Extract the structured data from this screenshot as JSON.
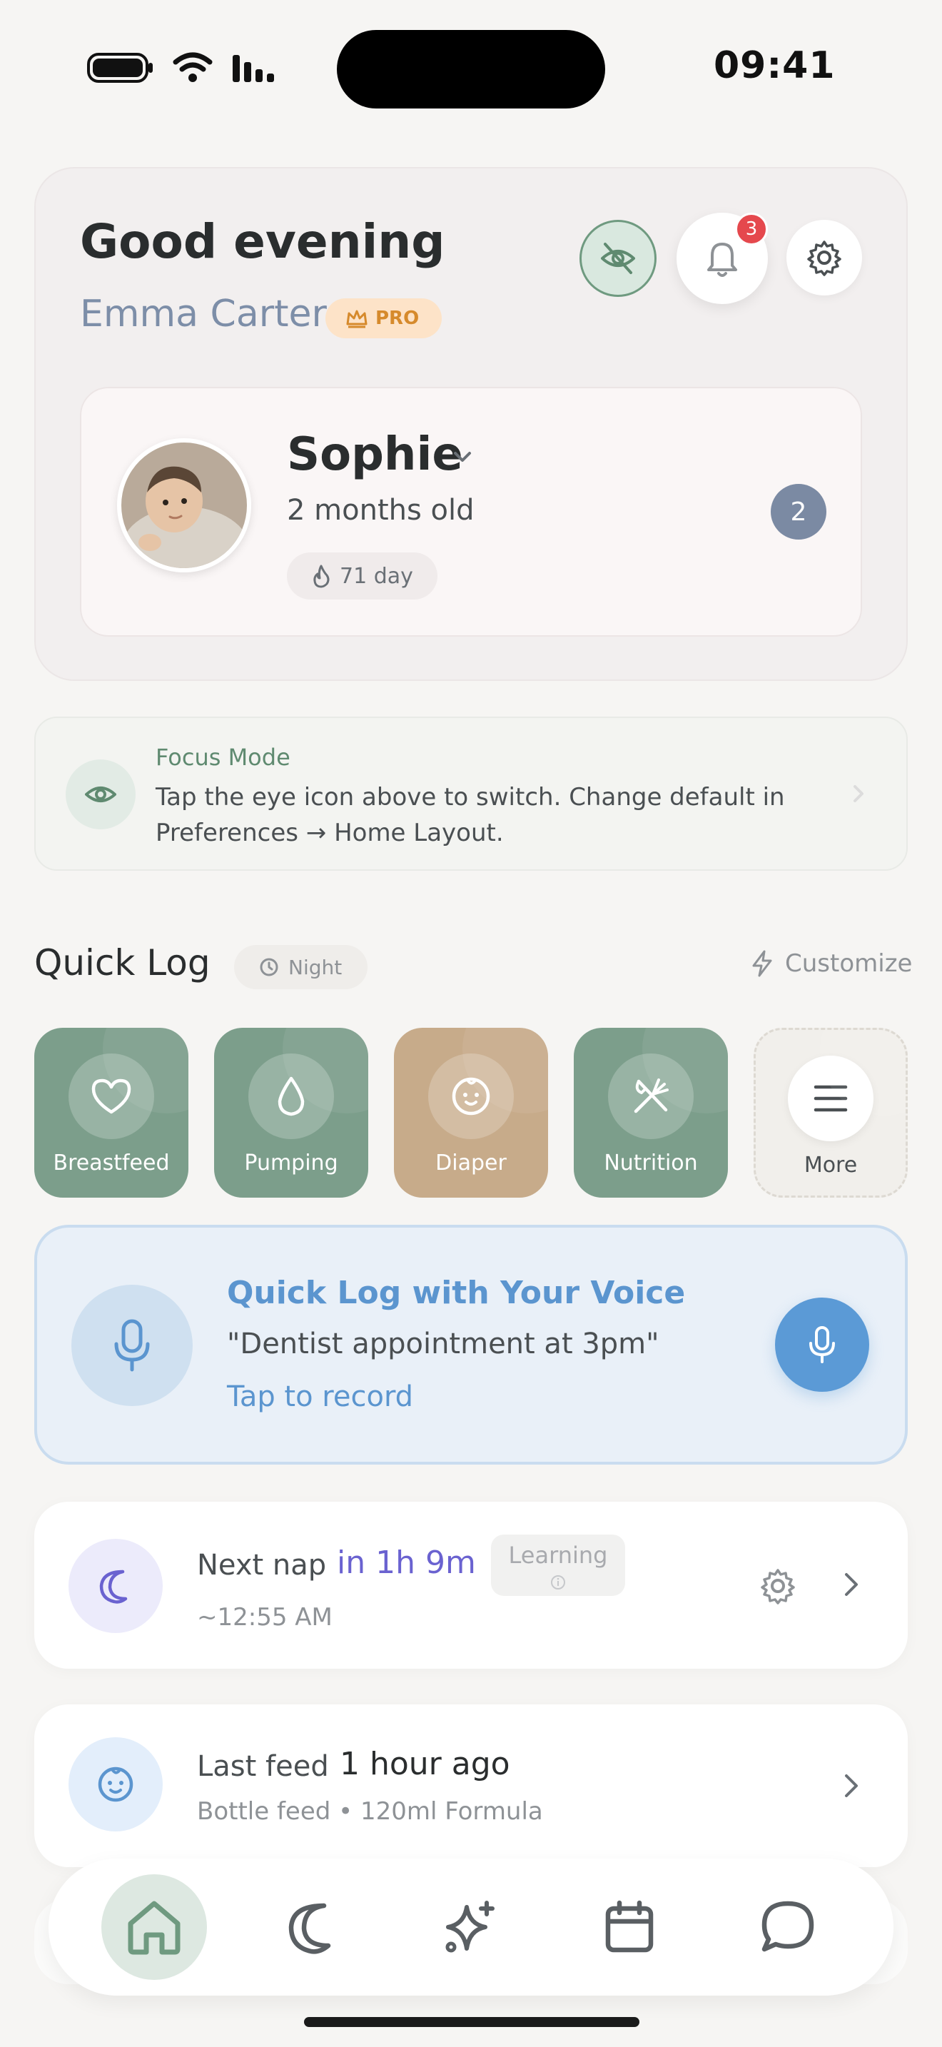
{
  "status_bar": {
    "time": "09:41"
  },
  "header": {
    "greeting": "Good evening",
    "user_name": "Emma Carter",
    "pro_badge": "PRO",
    "notification_count": "3",
    "colors": {
      "eye_active": "#6f9a80",
      "badge": "#e5484d",
      "pro": "#d68a2c"
    }
  },
  "baby": {
    "name": "Sophie",
    "age": "2 months old",
    "streak": "71 day",
    "count_badge": "2"
  },
  "focus_mode": {
    "title": "Focus Mode",
    "text": "Tap the eye icon above to switch. Change default in Preferences → Home Layout."
  },
  "quick_log": {
    "title": "Quick Log",
    "time_pill": "Night",
    "customize": "Customize",
    "tiles": [
      {
        "label": "Breastfeed",
        "icon": "heart-icon"
      },
      {
        "label": "Pumping",
        "icon": "drop-icon"
      },
      {
        "label": "Diaper",
        "icon": "baby-face-icon"
      },
      {
        "label": "Nutrition",
        "icon": "utensils-icon"
      },
      {
        "label": "More",
        "icon": "menu-icon"
      }
    ]
  },
  "voice": {
    "title": "Quick Log with Your Voice",
    "example": "\"Dentist appointment at 3pm\"",
    "tap_text": "Tap to record"
  },
  "nap": {
    "label": "Next nap",
    "value": "in 1h 9m",
    "pill": "Learning",
    "sub": "~12:55 AM"
  },
  "feed": {
    "label": "Last feed",
    "value": "1 hour ago",
    "sub": "Bottle feed • 120ml Formula"
  },
  "tab_bar": {
    "tabs": [
      "home-icon",
      "moon-icon",
      "sparkle-icon",
      "calendar-icon",
      "chat-icon"
    ],
    "active": "home-icon"
  }
}
